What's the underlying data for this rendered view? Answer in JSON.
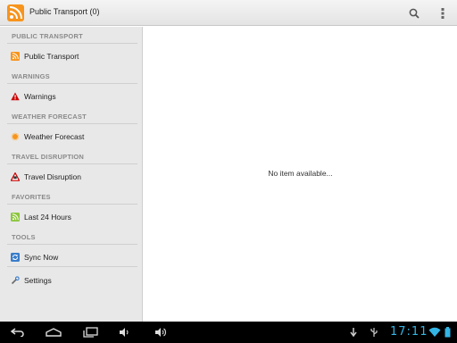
{
  "header": {
    "title": "Public Transport (0)",
    "app_icon": "rss-icon",
    "search_icon": "search-icon",
    "overflow_icon": "overflow-menu-icon"
  },
  "sidebar": {
    "sections": [
      {
        "header": "PUBLIC TRANSPORT",
        "item": "Public Transport",
        "icon": "rss-icon",
        "color": "#f7941d"
      },
      {
        "header": "WARNINGS",
        "item": "Warnings",
        "icon": "warning-icon",
        "color": "#cc0000"
      },
      {
        "header": "WEATHER FORECAST",
        "item": "Weather Forecast",
        "icon": "sun-icon",
        "color": "#f7941d"
      },
      {
        "header": "TRAVEL DISRUPTION",
        "item": "Travel Disruption",
        "icon": "disruption-icon",
        "color": "#cc0000"
      },
      {
        "header": "FAVORITES",
        "item": "Last 24 Hours",
        "icon": "rss-icon",
        "color": "#8dc63f"
      },
      {
        "header": "TOOLS",
        "item": "Sync Now",
        "icon": "sync-icon",
        "color": "#3a7dc9"
      }
    ],
    "settings": {
      "label": "Settings",
      "icon": "settings-icon"
    }
  },
  "content": {
    "empty_message": "No item available..."
  },
  "system_bar": {
    "time": "17:11",
    "accent": "#33b5e5"
  }
}
